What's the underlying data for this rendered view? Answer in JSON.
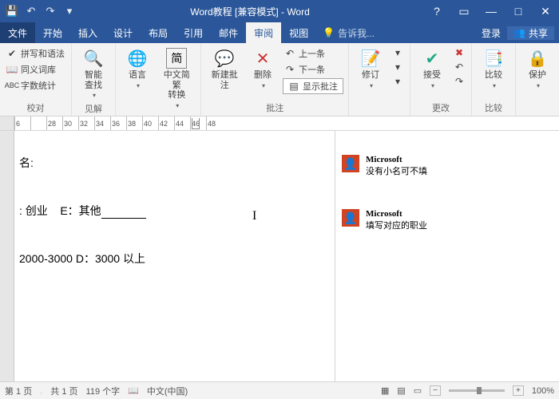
{
  "titlebar": {
    "title": "Word教程 [兼容模式] - Word"
  },
  "qat": {
    "save": "💾",
    "undo": "↶",
    "redo": "↷",
    "more": "▾"
  },
  "winctl": {
    "help": "?",
    "ribbonopt": "▭",
    "min": "—",
    "max": "□",
    "close": "✕"
  },
  "tabs": {
    "file": "文件",
    "home": "开始",
    "insert": "插入",
    "design": "设计",
    "layout": "布局",
    "references": "引用",
    "mailings": "邮件",
    "review": "审阅",
    "view": "视图",
    "tell": "告诉我...",
    "signin": "登录",
    "share": "共享"
  },
  "ribbon": {
    "proofing": {
      "spelling": "拼写和语法",
      "thesaurus": "同义词库",
      "wordcount": "字数统计",
      "label": "校对"
    },
    "insights": {
      "lookup": "智能\n查找",
      "label": "见解"
    },
    "language": {
      "lang": "语言",
      "convert": "中文简繁\n转换"
    },
    "comments": {
      "new": "新建批注",
      "delete": "删除",
      "prev": "上一条",
      "next": "下一条",
      "show": "显示批注",
      "label": "批注"
    },
    "tracking": {
      "track": "修订"
    },
    "changes": {
      "accept": "接受",
      "prev": "",
      "next": "",
      "reject": "",
      "label": "更改"
    },
    "compare": {
      "compare": "比较",
      "label": "比较"
    },
    "protect": {
      "protect": "保护"
    }
  },
  "ruler": {
    "ticks": [
      "6",
      "",
      "28",
      "30",
      "32",
      "34",
      "36",
      "38",
      "40",
      "42",
      "44",
      "46",
      "48"
    ]
  },
  "doc": {
    "line1": "名:",
    "line2_a": ": 创业",
    "line2_b": "E：其他",
    "line3": "2000-3000   D：3000 以上"
  },
  "comments_panel": [
    {
      "author": "Microsoft",
      "body": "没有小名可不填"
    },
    {
      "author": "Microsoft",
      "body": "填写对应的职业"
    }
  ],
  "status": {
    "page": "第 1 页",
    "pages": "共 1 页",
    "words": "119 个字",
    "lang": "中文(中国)",
    "zoom": "100%"
  }
}
